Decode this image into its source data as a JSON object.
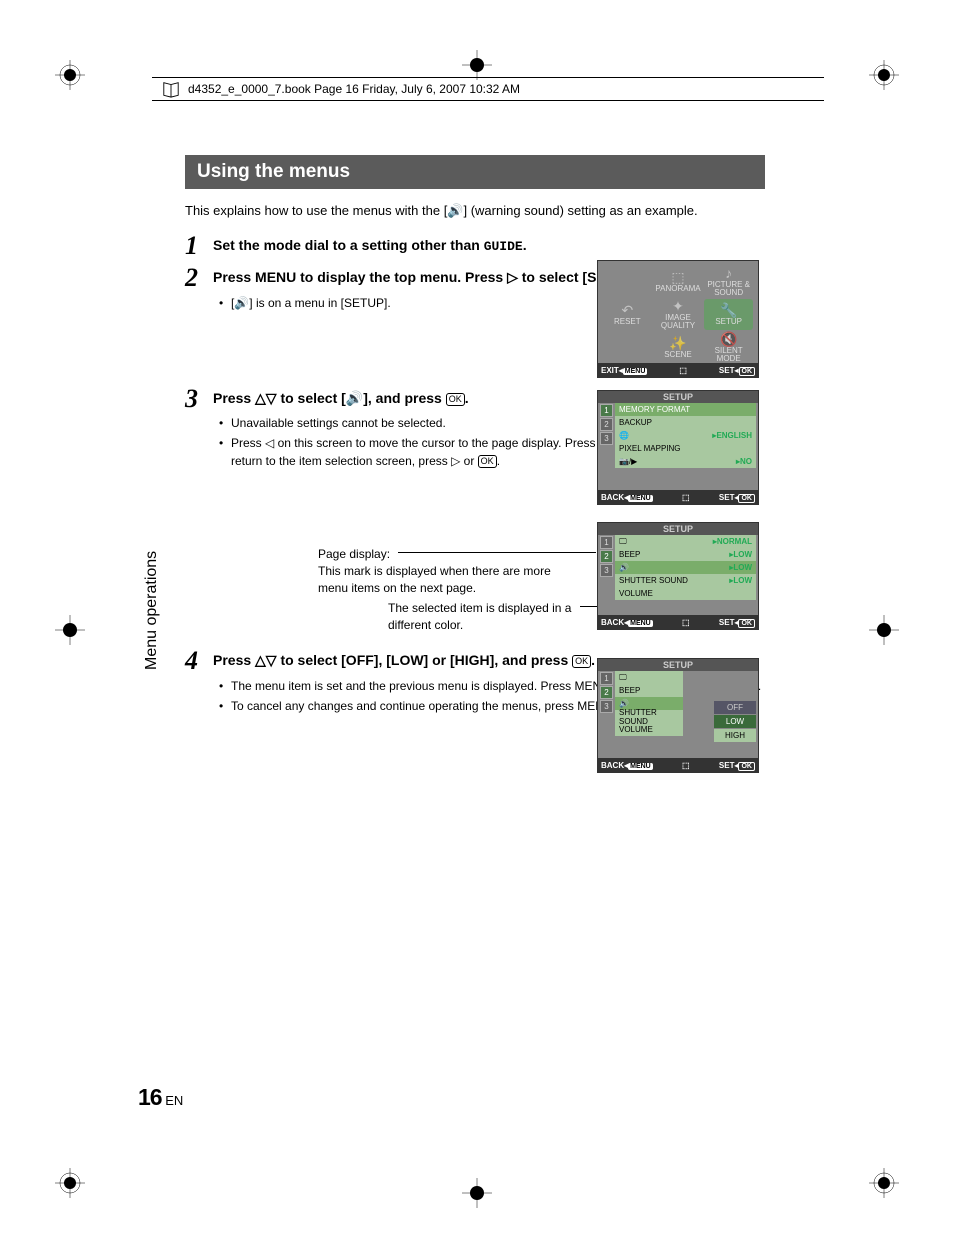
{
  "header": {
    "text": "d4352_e_0000_7.book  Page 16  Friday, July 6, 2007  10:32 AM"
  },
  "section_title": "Using the menus",
  "intro": "This explains how to use the menus with the [🔊] (warning sound) setting as an example.",
  "steps": {
    "s1": {
      "num": "1",
      "title_a": "Set the mode dial to a setting other than ",
      "guide": "GUIDE",
      "title_b": "."
    },
    "s2": {
      "num": "2",
      "title": "Press MENU to display the top menu. Press ▷ to select [SETUP], and press ",
      "bullet1": "[🔊] is on a menu in [SETUP]."
    },
    "s3": {
      "num": "3",
      "title_a": "Press △▽ to select [🔊], and press ",
      "bullet1": "Unavailable settings cannot be selected.",
      "bullet2a": "Press ◁ on this screen to move the cursor to the page display. Press △▽ to change the page. To return to the item selection screen, press ▷ or "
    },
    "s4": {
      "num": "4",
      "title": "Press △▽ to select [OFF], [LOW] or [HIGH], and press ",
      "bullet1": "The menu item is set and the previous menu is displayed. Press MENU repeatedly to exit the menu.",
      "bullet2a": "To cancel any changes and continue operating the menus, press MENU without pressing "
    }
  },
  "callouts": {
    "c1a": "Page display:",
    "c1b": "This mark is displayed when there are more menu items on the next page.",
    "c2": "The selected item is displayed in a different color."
  },
  "side_label": "Menu operations",
  "page": {
    "num": "16",
    "lang": "EN"
  },
  "screens": {
    "topmenu": {
      "cells": [
        "",
        "PANORAMA",
        "PICTURE & SOUND",
        "RESET",
        "IMAGE QUALITY",
        "SETUP",
        "",
        "SCENE",
        "SILENT MODE"
      ],
      "bar_l": "EXIT",
      "bar_lm": "MENU",
      "bar_r": "SET",
      "bar_rok": "OK"
    },
    "setup1": {
      "title": "SETUP",
      "rows": [
        {
          "label": "MEMORY FORMAT",
          "val": ""
        },
        {
          "label": "BACKUP",
          "val": ""
        },
        {
          "label": "🌐",
          "val": "ENGLISH"
        },
        {
          "label": "PIXEL MAPPING",
          "val": ""
        },
        {
          "label": "📷/▶",
          "val": "NO"
        }
      ],
      "bar_l": "BACK",
      "bar_lm": "MENU",
      "bar_r": "SET",
      "bar_rok": "OK"
    },
    "setup2": {
      "title": "SETUP",
      "rows": [
        {
          "label": "🖵",
          "val": "NORMAL"
        },
        {
          "label": "BEEP",
          "val": "LOW"
        },
        {
          "label": "🔊",
          "val": "LOW",
          "hi": true
        },
        {
          "label": "SHUTTER SOUND",
          "val": "LOW"
        },
        {
          "label": "VOLUME",
          "val": ""
        }
      ],
      "bar_l": "BACK",
      "bar_lm": "MENU",
      "bar_r": "SET",
      "bar_rok": "OK"
    },
    "setup3": {
      "title": "SETUP",
      "rows": [
        {
          "label": "🖵",
          "val": ""
        },
        {
          "label": "BEEP",
          "val": ""
        },
        {
          "label": "🔊",
          "val": ""
        },
        {
          "label": "SHUTTER SOUND",
          "val": ""
        },
        {
          "label": "VOLUME",
          "val": ""
        }
      ],
      "opts": [
        "OFF",
        "LOW",
        "HIGH"
      ],
      "bar_l": "BACK",
      "bar_lm": "MENU",
      "bar_r": "SET",
      "bar_rok": "OK"
    }
  }
}
